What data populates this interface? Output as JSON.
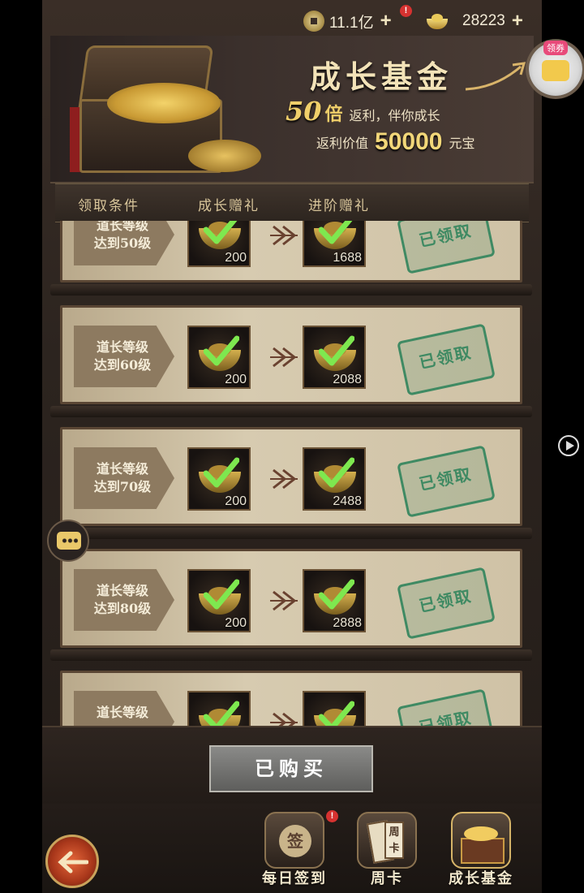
{
  "currency": {
    "coins": "11.1亿",
    "ingots": "28223",
    "alert": "!"
  },
  "banner": {
    "title": "成长基金",
    "multiplier": "50",
    "multiplier_unit": "倍",
    "tagline": "返利，伴你成长",
    "value_label": "返利价值",
    "value": "50000",
    "value_unit": "元宝"
  },
  "table_header": {
    "col_condition": "领取条件",
    "col_growth": "成长赠礼",
    "col_advanced": "进阶赠礼"
  },
  "rows": [
    {
      "cond_line1": "道长等级",
      "cond_line2": "达到50级",
      "growth_amount": "200",
      "advanced_amount": "1688",
      "status": "已领取"
    },
    {
      "cond_line1": "道长等级",
      "cond_line2": "达到60级",
      "growth_amount": "200",
      "advanced_amount": "2088",
      "status": "已领取"
    },
    {
      "cond_line1": "道长等级",
      "cond_line2": "达到70级",
      "growth_amount": "200",
      "advanced_amount": "2488",
      "status": "已领取"
    },
    {
      "cond_line1": "道长等级",
      "cond_line2": "达到80级",
      "growth_amount": "200",
      "advanced_amount": "2888",
      "status": "已领取"
    },
    {
      "cond_line1": "道长等级",
      "cond_line2": "",
      "growth_amount": "",
      "advanced_amount": "",
      "status": "已领取"
    }
  ],
  "purchase": {
    "label": "已购买"
  },
  "nav": {
    "daily_signin": "每日签到",
    "weekly_card": "周卡",
    "growth_fund": "成长基金",
    "signin_glyph": "签",
    "card_glyph": "周卡"
  },
  "coupon": {
    "label": "领券"
  },
  "colors": {
    "accent_gold": "#f0cf6a",
    "stamp_green": "#3f8a63",
    "alert_red": "#d63230"
  }
}
